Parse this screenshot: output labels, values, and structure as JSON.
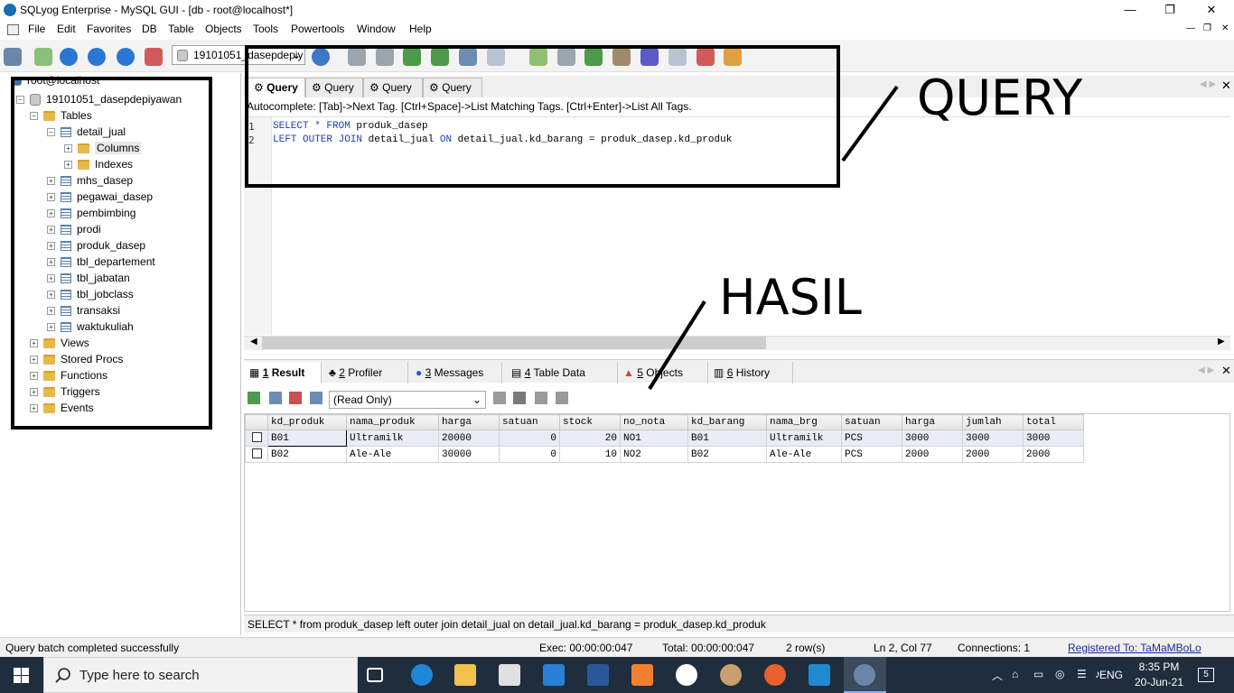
{
  "window": {
    "title": "SQLyog Enterprise - MySQL GUI - [db - root@localhost*]",
    "min": "—",
    "max": "❐",
    "close": "✕"
  },
  "menu": [
    {
      "label": "File"
    },
    {
      "label": "Edit"
    },
    {
      "label": "Favorites"
    },
    {
      "label": "DB"
    },
    {
      "label": "Table"
    },
    {
      "label": "Objects"
    },
    {
      "label": "Tools"
    },
    {
      "label": "Powertools"
    },
    {
      "label": "Window"
    },
    {
      "label": "Help"
    }
  ],
  "toolbar": {
    "db_selector": "19101051_dasepdepiy"
  },
  "tree": {
    "root": "root@localhost",
    "database": "19101051_dasepdepiyawan",
    "tables_label": "Tables",
    "detail_jual": "detail_jual",
    "columns": "Columns",
    "indexes": "Indexes",
    "tables": [
      "mhs_dasep",
      "pegawai_dasep",
      "pembimbing",
      "prodi",
      "produk_dasep",
      "tbl_departement",
      "tbl_jabatan",
      "tbl_jobclass",
      "transaksi",
      "waktukuliah"
    ],
    "groups": [
      "Views",
      "Stored Procs",
      "Functions",
      "Triggers",
      "Events"
    ]
  },
  "query_tabs": [
    "Query",
    "Query",
    "Query",
    "Query"
  ],
  "autocomplete": "Autocomplete: [Tab]->Next Tag. [Ctrl+Space]->List Matching Tags. [Ctrl+Enter]->List All Tags.",
  "editor": {
    "line1_no": "1",
    "line2_no": "2",
    "l1_kw1": "SELECT * FROM",
    "l1_rest": " produk_dasep",
    "l2_kw1": "LEFT OUTER JOIN",
    "l2_mid": " detail_jual ",
    "l2_kw2": "ON",
    "l2_rest": " detail_jual.kd_barang = produk_dasep.kd_produk"
  },
  "annotations": {
    "query": "QUERY",
    "hasil": "HASIL"
  },
  "result_tabs": [
    {
      "num": "1",
      "label": " Result"
    },
    {
      "num": "2",
      "label": " Profiler"
    },
    {
      "num": "3",
      "label": " Messages"
    },
    {
      "num": "4",
      "label": " Table Data"
    },
    {
      "num": "5",
      "label": " Objects"
    },
    {
      "num": "6",
      "label": " History"
    }
  ],
  "result_mode": "(Read Only)",
  "grid": {
    "columns": [
      "kd_produk",
      "nama_produk",
      "harga",
      "satuan",
      "stock",
      "no_nota",
      "kd_barang",
      "nama_brg",
      "satuan",
      "harga",
      "jumlah",
      "total"
    ],
    "rows": [
      [
        "B01",
        "Ultramilk",
        "20000",
        "0",
        "20",
        "NO1",
        "B01",
        "Ultramilk",
        "PCS",
        "3000",
        "3000",
        "3000"
      ],
      [
        "B02",
        "Ale-Ale",
        "30000",
        "0",
        "10",
        "NO2",
        "B02",
        "Ale-Ale",
        "PCS",
        "2000",
        "2000",
        "2000"
      ]
    ]
  },
  "sql_line": "SELECT * from produk_dasep  left outer join detail_jual on detail_jual.kd_barang = produk_dasep.kd_produk",
  "status": {
    "message": "Query batch completed successfully",
    "exec": "Exec: 00:00:00:047",
    "total": "Total: 00:00:00:047",
    "rows": "2 row(s)",
    "position": "Ln 2, Col 77",
    "connections": "Connections: 1",
    "registered": "Registered To: TaMaMBoLo"
  },
  "taskbar": {
    "search_placeholder": "Type here to search",
    "lang": "ENG",
    "time": "8:35 PM",
    "date": "20-Jun-21",
    "notif": "5"
  },
  "colors": {
    "keyword": "#1a40c0",
    "taskbar": "#1f2d3d",
    "row_highlight": "#e8ecf6"
  }
}
